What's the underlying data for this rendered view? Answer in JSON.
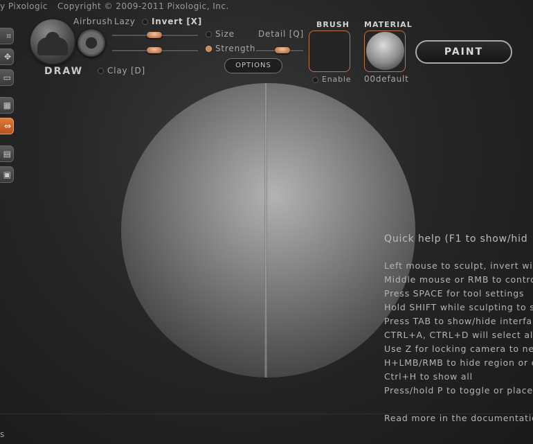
{
  "header": {
    "left_text": "y Pixologic",
    "copyright": "Copyright © 2009-2011 Pixologic, Inc."
  },
  "tool": {
    "draw_label": "DRAW",
    "airbrush_label": "Airbrush",
    "lazy_label": "Lazy",
    "invert_label": "Invert [X]",
    "clay_label": "Clay [D]",
    "size_label": "Size",
    "detail_label": "Detail [Q]",
    "strength_label": "Strength",
    "options_label": "OPTIONS"
  },
  "brush": {
    "title": "BRUSH",
    "enable_label": "Enable"
  },
  "material": {
    "title": "MATERIAL",
    "name": "00default"
  },
  "paint_label": "PAINT",
  "quick_help": {
    "title": "Quick help (F1 to show/hid",
    "lines": [
      "Left mouse to sculpt, invert wi",
      "Middle mouse or RMB to contro",
      "Press SPACE for tool settings",
      "Hold SHIFT while sculpting to s",
      "Press TAB to show/hide interfa",
      "CTRL+A, CTRL+D will select all",
      "Use Z for locking camera to nea",
      "H+LMB/RMB to hide region or o",
      "Ctrl+H to show all",
      "Press/hold P to toggle or place"
    ],
    "read_more": "Read more in the documentatio"
  },
  "bottom_text": "s",
  "colors": {
    "accent": "#c0724a",
    "active_button": "#d46a2e"
  }
}
